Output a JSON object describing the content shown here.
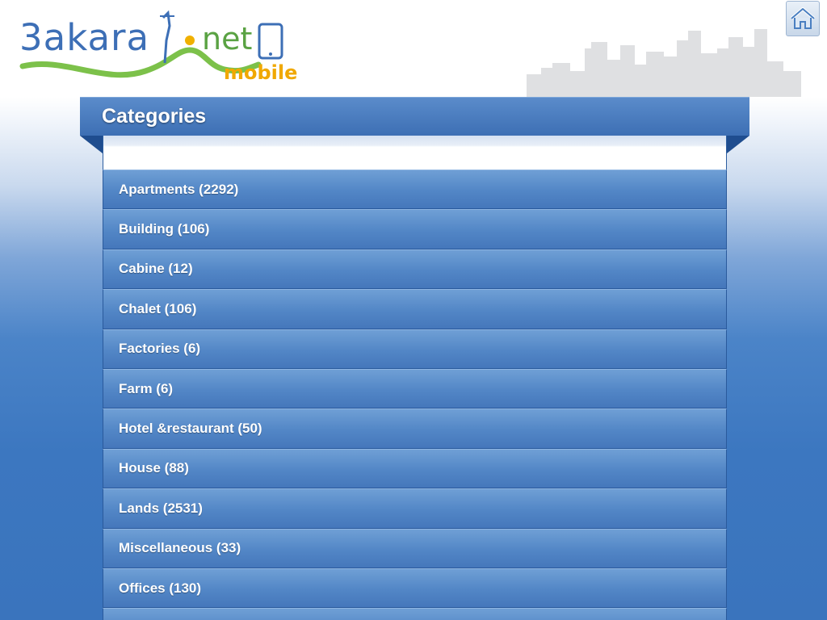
{
  "brand": {
    "name": "3akara",
    "suffix": "net",
    "tagline": "mobile",
    "colors": {
      "blue": "#3d6fb6",
      "green": "#5aa243",
      "orange": "#f0a800"
    }
  },
  "header": {
    "home_icon": "home-icon"
  },
  "panel": {
    "title": "Categories"
  },
  "categories": [
    {
      "label": "Apartments (2292)"
    },
    {
      "label": "Building (106)"
    },
    {
      "label": "Cabine (12)"
    },
    {
      "label": "Chalet (106)"
    },
    {
      "label": "Factories (6)"
    },
    {
      "label": "Farm (6)"
    },
    {
      "label": "Hotel &restaurant (50)"
    },
    {
      "label": "House (88)"
    },
    {
      "label": "Lands (2531)"
    },
    {
      "label": "Miscellaneous (33)"
    },
    {
      "label": "Offices (130)"
    },
    {
      "label": ""
    }
  ]
}
